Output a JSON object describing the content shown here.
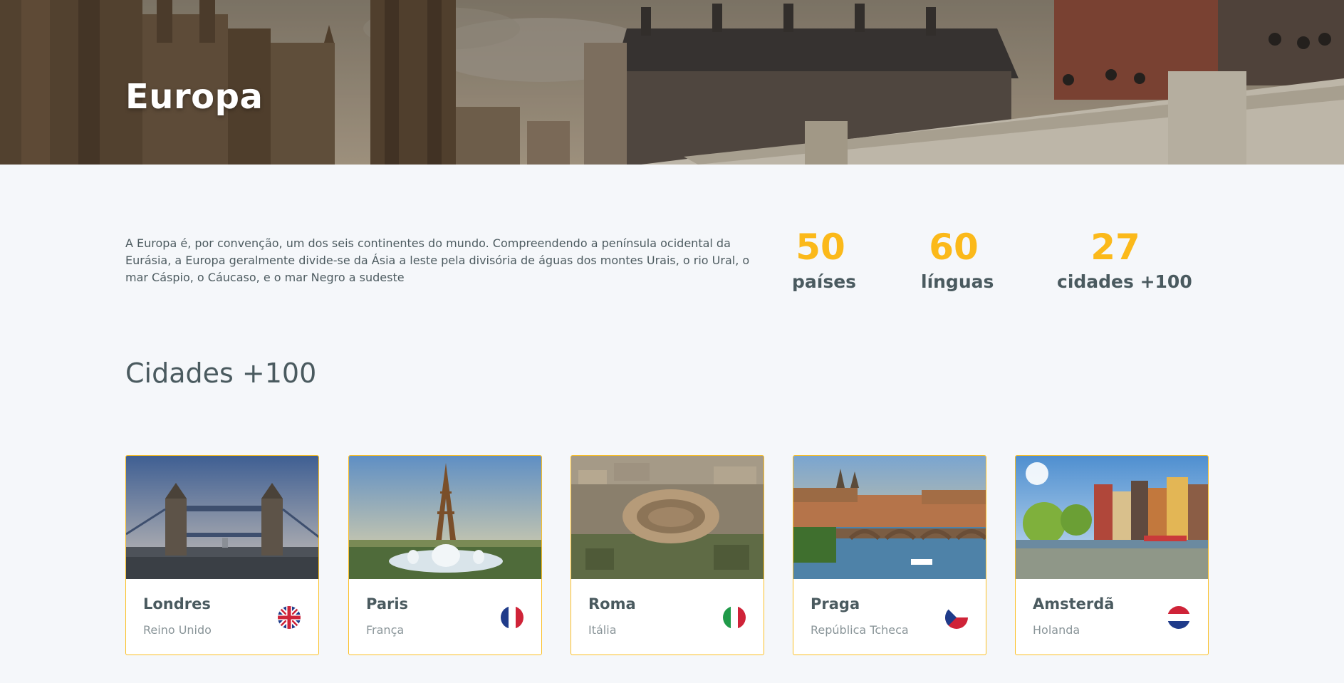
{
  "hero": {
    "title": "Europa"
  },
  "intro": {
    "text": "A Europa é, por convenção, um dos seis continentes do mundo. Compreendendo a península ocidental da Eurásia, a Europa geralmente divide-se da Ásia a leste pela divisória de águas dos montes Urais, o rio Ural, o mar Cáspio, o Cáucaso, e o mar Negro a sudeste"
  },
  "stats": [
    {
      "value": "50",
      "label": "países"
    },
    {
      "value": "60",
      "label": "línguas"
    },
    {
      "value": "27",
      "label": "cidades +100"
    }
  ],
  "section": {
    "title": "Cidades +100"
  },
  "cities": [
    {
      "name": "Londres",
      "country": "Reino Unido",
      "flag_icon": "uk-flag-icon"
    },
    {
      "name": "Paris",
      "country": "França",
      "flag_icon": "france-flag-icon"
    },
    {
      "name": "Roma",
      "country": "Itália",
      "flag_icon": "italy-flag-icon"
    },
    {
      "name": "Praga",
      "country": "República Tcheca",
      "flag_icon": "czech-flag-icon"
    },
    {
      "name": "Amsterdã",
      "country": "Holanda",
      "flag_icon": "netherlands-flag-icon"
    }
  ],
  "colors": {
    "accent": "#fbb91a",
    "card_border": "#fbbf24",
    "text": "#4a5a5f",
    "muted": "#8a9599",
    "background": "#f5f7fa"
  }
}
